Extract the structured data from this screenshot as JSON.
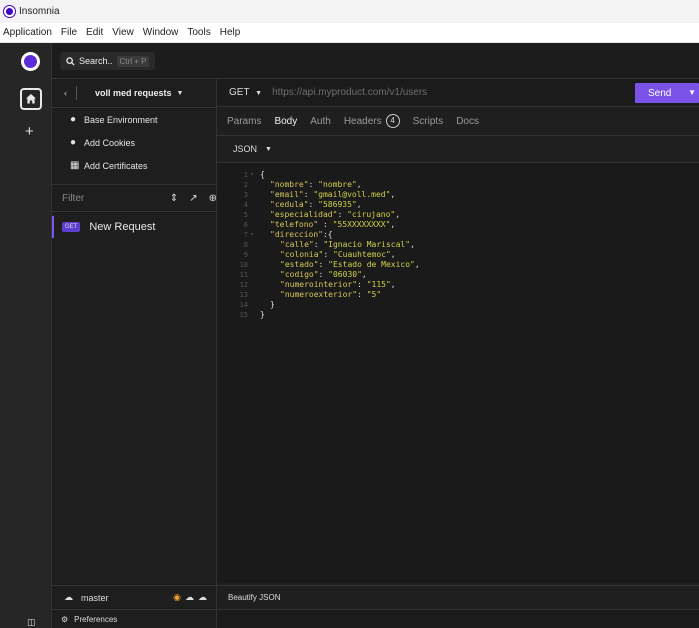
{
  "window": {
    "title": "Insomnia"
  },
  "menu": [
    "Application",
    "File",
    "Edit",
    "View",
    "Window",
    "Tools",
    "Help"
  ],
  "search": {
    "label": "Search..",
    "shortcut": "Ctrl + P"
  },
  "project": {
    "name": "voll med requests",
    "items": [
      {
        "icon": "globe-icon",
        "label": "Base Environment"
      },
      {
        "icon": "cookie-icon",
        "label": "Add Cookies"
      },
      {
        "icon": "certificate-icon",
        "label": "Add Certificates"
      }
    ],
    "filter_placeholder": "Filter",
    "requests": [
      {
        "method": "GET",
        "name": "New Request"
      }
    ],
    "branch": "master",
    "preferences": "Preferences"
  },
  "request": {
    "method": "GET",
    "url_placeholder": "https://api.myproduct.com/v1/users",
    "send_label": "Send",
    "tabs": [
      {
        "label": "Params"
      },
      {
        "label": "Body"
      },
      {
        "label": "Auth"
      },
      {
        "label": "Headers",
        "count": "4"
      },
      {
        "label": "Scripts"
      },
      {
        "label": "Docs"
      }
    ],
    "active_tab": "Body",
    "body_type": "JSON",
    "beautify_label": "Beautify JSON"
  },
  "editor": {
    "lines": [
      {
        "n": "1",
        "fold": true,
        "indent": 0,
        "parts": [
          {
            "t": "{",
            "c": "p"
          }
        ]
      },
      {
        "n": "2",
        "indent": 1,
        "parts": [
          {
            "t": "\"nombre\"",
            "c": "k"
          },
          {
            "t": ": ",
            "c": "p"
          },
          {
            "t": "\"nombre\"",
            "c": "s"
          },
          {
            "t": ",",
            "c": "p"
          }
        ]
      },
      {
        "n": "3",
        "indent": 1,
        "parts": [
          {
            "t": "\"email\"",
            "c": "k"
          },
          {
            "t": ": ",
            "c": "p"
          },
          {
            "t": "\"gmail@voll.med\"",
            "c": "s"
          },
          {
            "t": ",",
            "c": "p"
          }
        ]
      },
      {
        "n": "4",
        "indent": 1,
        "parts": [
          {
            "t": "\"cedula\"",
            "c": "k"
          },
          {
            "t": ": ",
            "c": "p"
          },
          {
            "t": "\"586935\"",
            "c": "s"
          },
          {
            "t": ",",
            "c": "p"
          }
        ]
      },
      {
        "n": "5",
        "indent": 1,
        "parts": [
          {
            "t": "\"especialidad\"",
            "c": "k"
          },
          {
            "t": ": ",
            "c": "p"
          },
          {
            "t": "\"cirujano\"",
            "c": "s"
          },
          {
            "t": ",",
            "c": "p"
          }
        ]
      },
      {
        "n": "6",
        "indent": 1,
        "parts": [
          {
            "t": "\"telefono\"",
            "c": "k"
          },
          {
            "t": " : ",
            "c": "p"
          },
          {
            "t": "\"55XXXXXXXX\"",
            "c": "s"
          },
          {
            "t": ",",
            "c": "p"
          }
        ]
      },
      {
        "n": "7",
        "fold": true,
        "indent": 1,
        "parts": [
          {
            "t": "\"direccion\"",
            "c": "k"
          },
          {
            "t": ":{",
            "c": "p"
          }
        ]
      },
      {
        "n": "8",
        "indent": 2,
        "parts": [
          {
            "t": "\"calle\"",
            "c": "k"
          },
          {
            "t": ": ",
            "c": "p"
          },
          {
            "t": "\"Ignacio Mariscal\"",
            "c": "s"
          },
          {
            "t": ",",
            "c": "p"
          }
        ]
      },
      {
        "n": "9",
        "indent": 2,
        "parts": [
          {
            "t": "\"colonia\"",
            "c": "k"
          },
          {
            "t": ": ",
            "c": "p"
          },
          {
            "t": "\"Cuauhtemoc\"",
            "c": "s"
          },
          {
            "t": ",",
            "c": "p"
          }
        ]
      },
      {
        "n": "10",
        "indent": 2,
        "parts": [
          {
            "t": "\"estado\"",
            "c": "k"
          },
          {
            "t": ": ",
            "c": "p"
          },
          {
            "t": "\"Estado de Mexico\"",
            "c": "s"
          },
          {
            "t": ",",
            "c": "p"
          }
        ]
      },
      {
        "n": "11",
        "indent": 2,
        "parts": [
          {
            "t": "\"codigo\"",
            "c": "k"
          },
          {
            "t": ": ",
            "c": "p"
          },
          {
            "t": "\"06030\"",
            "c": "s"
          },
          {
            "t": ",",
            "c": "p"
          }
        ]
      },
      {
        "n": "12",
        "indent": 2,
        "parts": [
          {
            "t": "\"numerointerior\"",
            "c": "k"
          },
          {
            "t": ": ",
            "c": "p"
          },
          {
            "t": "\"115\"",
            "c": "s"
          },
          {
            "t": ",",
            "c": "p"
          }
        ]
      },
      {
        "n": "13",
        "indent": 2,
        "parts": [
          {
            "t": "\"numeroexterior\"",
            "c": "k"
          },
          {
            "t": ": ",
            "c": "p"
          },
          {
            "t": "\"5\"",
            "c": "s"
          }
        ]
      },
      {
        "n": "14",
        "indent": 1,
        "parts": [
          {
            "t": "}",
            "c": "p"
          }
        ]
      },
      {
        "n": "15",
        "indent": 0,
        "parts": [
          {
            "t": "}",
            "c": "p"
          }
        ]
      }
    ]
  },
  "colors": {
    "accent": "#7a52e8",
    "badge": "#5e3fd2"
  }
}
